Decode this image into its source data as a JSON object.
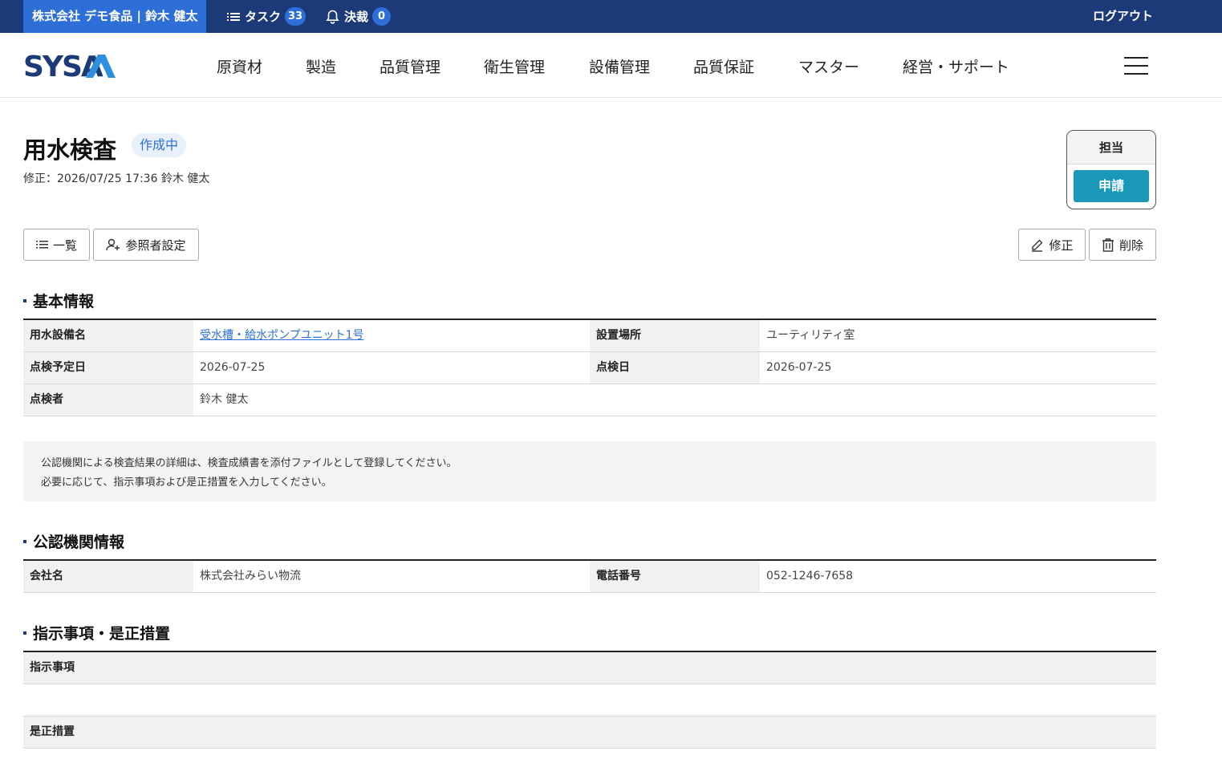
{
  "topbar": {
    "company": "株式会社 デモ食品 | 鈴木 健太",
    "task_label": "タスク",
    "task_count": "33",
    "approval_label": "決裁",
    "approval_count": "0",
    "logout": "ログアウト"
  },
  "nav": {
    "logo_text": "SYSA",
    "items": [
      "原資材",
      "製造",
      "品質管理",
      "衛生管理",
      "設備管理",
      "品質保証",
      "マスター",
      "経営・サポート"
    ]
  },
  "page": {
    "title": "用水検査",
    "status": "作成中",
    "modified": "修正：2026/07/25 17:36  鈴木 健太",
    "assign_header": "担当",
    "apply_button": "申請",
    "list_button": "一覧",
    "viewer_button": "参照者設定",
    "edit_button": "修正",
    "delete_button": "削除"
  },
  "basic": {
    "title": "基本情報",
    "facility_label": "用水設備名",
    "facility_value": "受水槽・給水ポンプユニット1号",
    "location_label": "設置場所",
    "location_value": "ユーティリティ室",
    "scheduled_label": "点検予定日",
    "scheduled_value": "2026-07-25",
    "inspection_date_label": "点検日",
    "inspection_date_value": "2026-07-25",
    "inspector_label": "点検者",
    "inspector_value": "鈴木 健太"
  },
  "notice": {
    "line1": "公認機関による検査結果の詳細は、検査成績書を添付ファイルとして登録してください。",
    "line2": "必要に応じて、指示事項および是正措置を入力してください。"
  },
  "agency": {
    "title": "公認機関情報",
    "company_label": "会社名",
    "company_value": "株式会社みらい物流",
    "phone_label": "電話番号",
    "phone_value": "052-1246-7658"
  },
  "instructions": {
    "title": "指示事項・是正措置",
    "instruction_label": "指示事項",
    "correction_label": "是正措置"
  },
  "colors": {
    "topbar": "#1c3a78",
    "accent": "#2d6fd6",
    "apply": "#1998b8"
  }
}
